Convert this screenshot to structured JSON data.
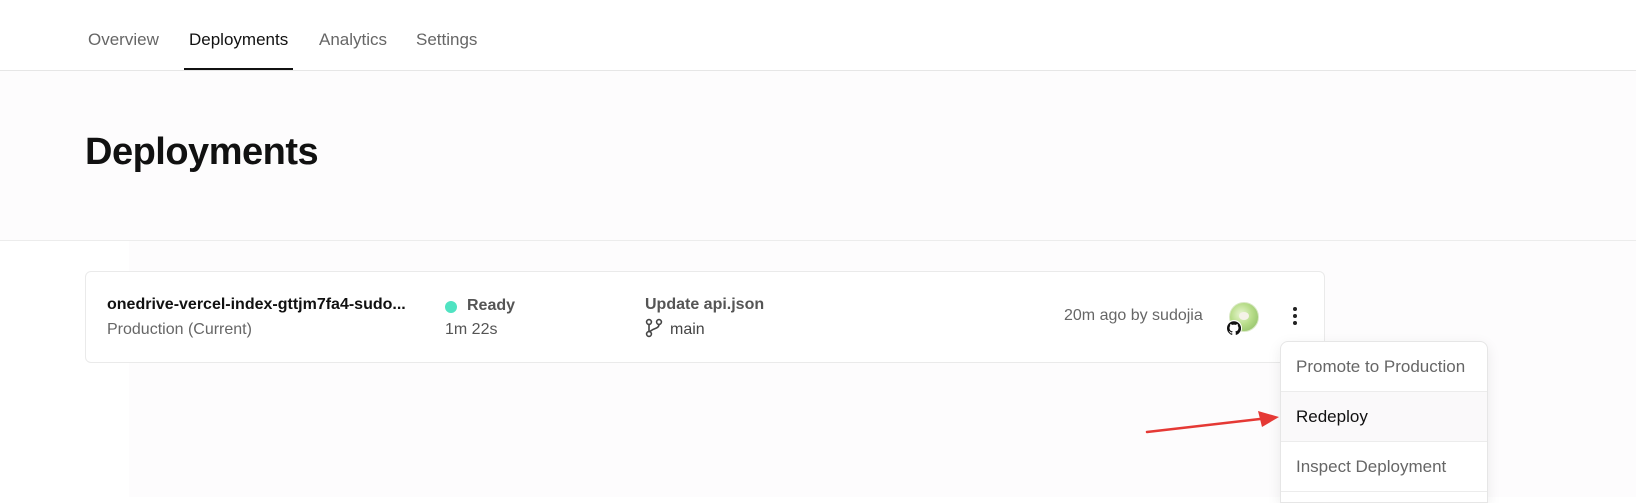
{
  "tabs": [
    {
      "label": "Overview",
      "active": false
    },
    {
      "label": "Deployments",
      "active": true
    },
    {
      "label": "Analytics",
      "active": false
    },
    {
      "label": "Settings",
      "active": false
    }
  ],
  "page": {
    "title": "Deployments"
  },
  "deployment": {
    "name": "onedrive-vercel-index-gttjm7fa4-sudo...",
    "environment": "Production (Current)",
    "status": "Ready",
    "status_color": "#50e3c2",
    "duration": "1m 22s",
    "commit_message": "Update api.json",
    "branch": "main",
    "meta": "20m ago by sudojia",
    "avatar_icon": "user-avatar",
    "git_provider_icon": "github-icon",
    "more_icon": "more-vertical-icon"
  },
  "menu": {
    "items": [
      {
        "label": "Promote to Production"
      },
      {
        "label": "Redeploy"
      },
      {
        "label": "Inspect Deployment"
      }
    ]
  },
  "annotation": {
    "arrow_color": "#e53935"
  }
}
